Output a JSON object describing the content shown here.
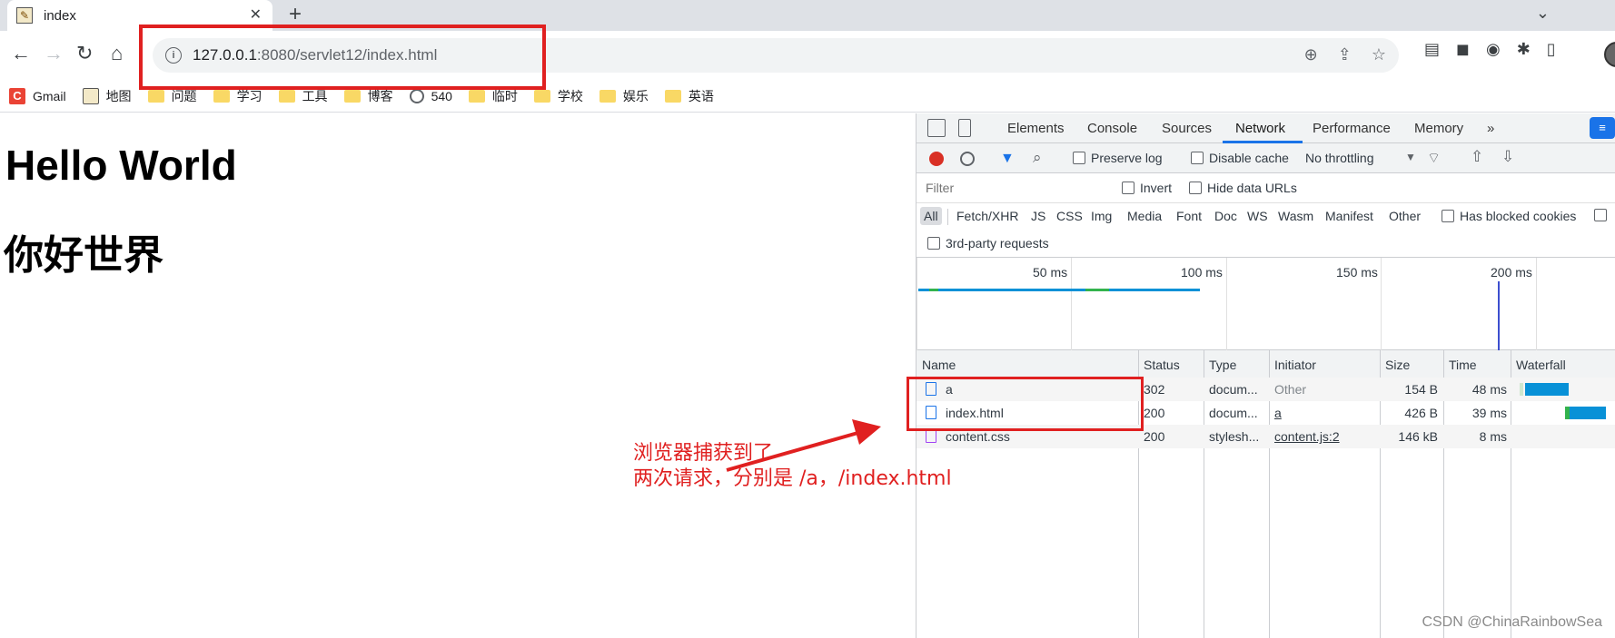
{
  "browser": {
    "tab_title": "index",
    "url_host": "127.0.0.1",
    "url_rest": ":8080/servlet12/index.html",
    "bookmarks": [
      "Gmail",
      "地图",
      "问题",
      "学习",
      "工具",
      "博客",
      "540",
      "临时",
      "学校",
      "娱乐",
      "英语"
    ]
  },
  "page": {
    "heading1": "Hello World",
    "heading2": "你好世界"
  },
  "annotation": {
    "line1": "浏览器捕获到了",
    "line2": "两次请求，分别是 /a，/index.html",
    "color": "#e02020"
  },
  "devtools": {
    "tabs": [
      "Elements",
      "Console",
      "Sources",
      "Network",
      "Performance",
      "Memory",
      "»"
    ],
    "active_tab": "Network",
    "controls": {
      "preserve_log": "Preserve log",
      "disable_cache": "Disable cache",
      "throttling": "No throttling"
    },
    "filter": {
      "placeholder": "Filter",
      "invert": "Invert",
      "hide_data_urls": "Hide data URLs"
    },
    "types": [
      "All",
      "Fetch/XHR",
      "JS",
      "CSS",
      "Img",
      "Media",
      "Font",
      "Doc",
      "WS",
      "Wasm",
      "Manifest",
      "Other"
    ],
    "has_blocked_cookies": "Has blocked cookies",
    "third_party": "3rd-party requests",
    "overview_ticks": [
      "50 ms",
      "100 ms",
      "150 ms",
      "200 ms"
    ],
    "columns": [
      "Name",
      "Status",
      "Type",
      "Initiator",
      "Size",
      "Time",
      "Waterfall"
    ],
    "rows": [
      {
        "name": "a",
        "status": "302",
        "type": "docum...",
        "initiator": "Other",
        "size": "154 B",
        "time": "48 ms"
      },
      {
        "name": "index.html",
        "status": "200",
        "type": "docum...",
        "initiator": "a",
        "size": "426 B",
        "time": "39 ms"
      },
      {
        "name": "content.css",
        "status": "200",
        "type": "stylesh...",
        "initiator": "content.js:2",
        "size": "146 kB",
        "time": "8 ms"
      }
    ]
  },
  "watermark": "CSDN @ChinaRainbowSea"
}
